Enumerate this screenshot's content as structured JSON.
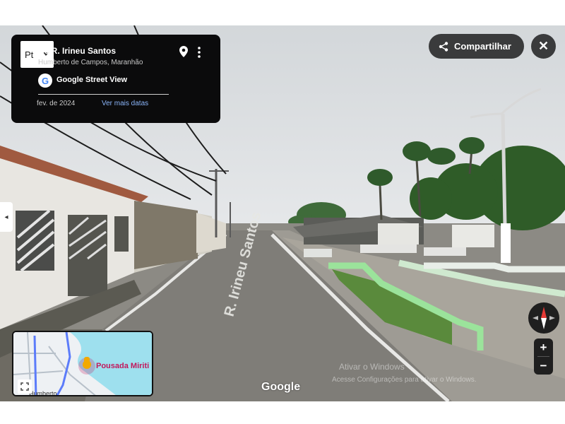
{
  "info_card": {
    "language_value": "Pt",
    "address_title": "56 R. Irineu Santos",
    "address_subtitle": "Humberto de Campos, Maranhão",
    "service_label": "Google Street View",
    "g_letter": "G",
    "capture_date": "fev. de 2024",
    "more_dates_label": "Ver mais datas"
  },
  "controls": {
    "share_label": "Compartilhar",
    "close_glyph": "✕",
    "side_panel_glyph": "◂",
    "zoom_in_label": "+",
    "zoom_out_label": "−"
  },
  "scene": {
    "street_marking": "R. Irineu Santos",
    "watermark": "Google"
  },
  "minimap": {
    "place_label": "Pousada Miriti",
    "town_label": "Humberto"
  },
  "os_overlay": {
    "line1": "Ativar o Windows",
    "line2": "Acesse Configurações para ativar o Windows."
  },
  "colors": {
    "panel": "#0b0b0c",
    "button": "#3a3b3c",
    "link": "#8ab4f8",
    "curb_green": "#9be39b",
    "minimap_water": "#9ee0ee",
    "compass_red": "#e53935"
  }
}
